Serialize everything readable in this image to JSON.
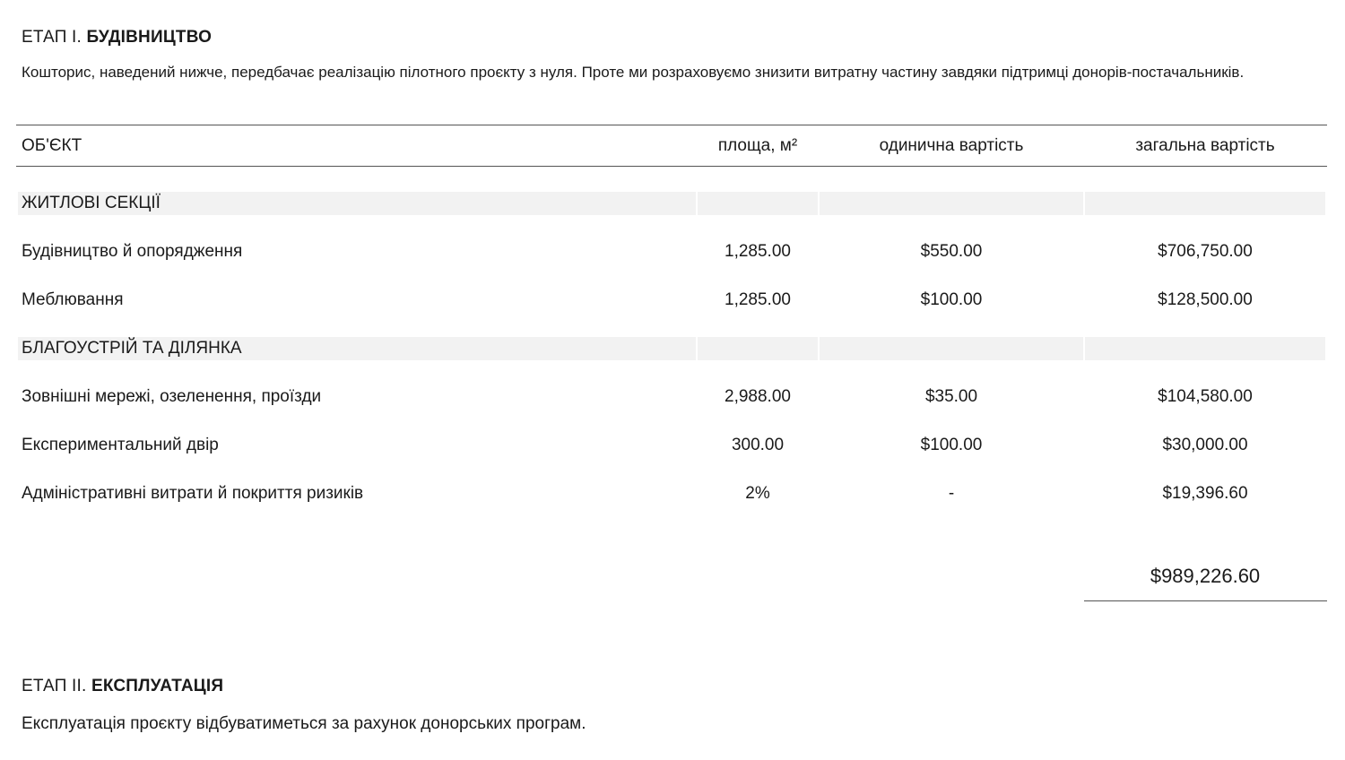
{
  "stage1": {
    "prefix": "ЕТАП І. ",
    "title": "БУДІВНИЦТВО",
    "intro": "Кошторис, наведений нижче, передбачає реалізацію пілотного проєкту з нуля. Проте ми розраховуємо знизити витратну частину завдяки підтримці донорів-постачальників."
  },
  "table": {
    "headers": {
      "object": "ОБ'ЄКТ",
      "area": "площа, м²",
      "unit_cost": "одинична вартість",
      "total_cost": "загальна вартість"
    },
    "sections": [
      {
        "name": "ЖИТЛОВІ СЕКЦІЇ",
        "rows": [
          {
            "object": "Будівництво й опорядження",
            "area": "1,285.00",
            "unit_cost": "$550.00",
            "total_cost": "$706,750.00"
          },
          {
            "object": "Меблювання",
            "area": "1,285.00",
            "unit_cost": "$100.00",
            "total_cost": "$128,500.00"
          }
        ]
      },
      {
        "name": "БЛАГОУСТРІЙ ТА ДІЛЯНКА",
        "rows": [
          {
            "object": "Зовнішні мережі, озеленення, проїзди",
            "area": "2,988.00",
            "unit_cost": "$35.00",
            "total_cost": "$104,580.00"
          },
          {
            "object": "Експериментальний двір",
            "area": "300.00",
            "unit_cost": "$100.00",
            "total_cost": "$30,000.00"
          },
          {
            "object": "Адміністративні витрати й покриття ризиків",
            "area": "2%",
            "unit_cost": "-",
            "total_cost": "$19,396.60"
          }
        ]
      }
    ],
    "grand_total": "$989,226.60"
  },
  "stage2": {
    "prefix": "ЕТАП ІІ. ",
    "title": "ЕКСПЛУАТАЦІЯ",
    "intro": "Експлуатація проєкту відбуватиметься за рахунок донорських програм."
  }
}
